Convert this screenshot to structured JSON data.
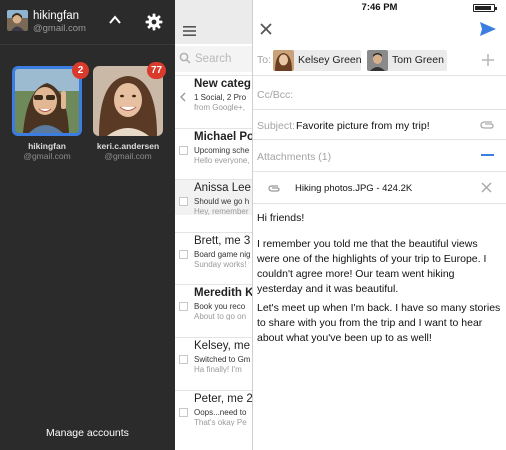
{
  "drawer": {
    "account_name": "hikingfan",
    "account_email": "@gmail.com",
    "accounts": [
      {
        "name": "hikingfan",
        "email": "@gmail.com",
        "badge": "2"
      },
      {
        "name": "keri.c.andersen",
        "email": "@gmail.com",
        "badge": "77"
      }
    ],
    "manage_label": "Manage accounts",
    "colors": {
      "background": "#2b2b2b",
      "selection": "#3b7de0",
      "badge": "#d93a2b"
    }
  },
  "inbox": {
    "search_placeholder": "Search",
    "messages": [
      {
        "sender": "New categ",
        "line1": "1 Social, 2 Pro",
        "line2": "from Google+, ",
        "bold": true
      },
      {
        "sender": "Michael Po",
        "line1": "Upcoming sche",
        "line2": "Hello everyone,",
        "bold": true
      },
      {
        "sender": "Anissa Lee",
        "line1": "Should we go h",
        "line2": "Hey, remember",
        "bold": false
      },
      {
        "sender": "Brett, me 3",
        "line1": "Board game nig",
        "line2": "Sunday works!",
        "bold": false
      },
      {
        "sender": "Meredith K",
        "line1": "Book you reco",
        "line2": "About to go on",
        "bold": true
      },
      {
        "sender": "Kelsey, me",
        "line1": "Switched to Gm",
        "line2": "Ha finally! I'm",
        "bold": false
      },
      {
        "sender": "Peter, me 2",
        "line1": "Oops...need to",
        "line2": "That's okay Pe",
        "bold": false
      }
    ]
  },
  "compose": {
    "status_time": "7:46 PM",
    "to_label": "To:",
    "recipients": [
      {
        "name": "Kelsey Green"
      },
      {
        "name": "Tom Green"
      }
    ],
    "cc_label": "Cc/Bcc:",
    "subject_label": "Subject:",
    "subject_value": "Favorite picture from my trip!",
    "attachments_label": "Attachments (1)",
    "attachment_name": "Hiking photos.JPG - 424.2K",
    "body": [
      "Hi friends!",
      "I remember you told me that the beautiful views were one of the highlights of your trip to Europe. I couldn't agree more! Our team went hiking yesterday and it was beautiful.",
      "Let's meet up when I'm back. I have so many stories to share with you from the trip and I want to hear about what you've been up to as well!"
    ],
    "colors": {
      "accent": "#3b7de0"
    }
  }
}
